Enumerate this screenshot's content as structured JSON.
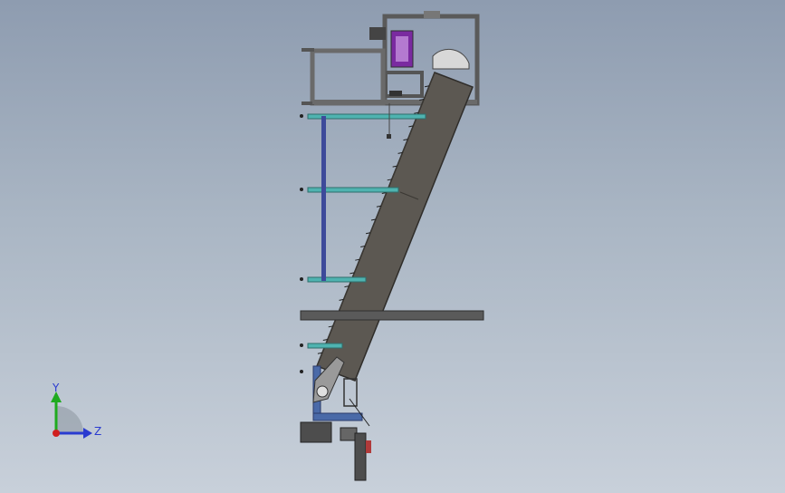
{
  "viewport": {
    "background_top": "#8e9cb0",
    "background_bottom": "#c8d0da"
  },
  "model": {
    "frame_color": "#6e6e6e",
    "conveyor_color": "#5c5852",
    "rail_color": "#4fb3b0",
    "strut_color": "#3d4a9a",
    "motor_color": "#4d4d4d",
    "accent_purple": "#7a2aa0"
  },
  "triad": {
    "y_label": "Y",
    "z_label": "Z",
    "y_color": "#1faa1f",
    "z_color": "#2a3bd0",
    "x_color": "#d01f1f"
  }
}
